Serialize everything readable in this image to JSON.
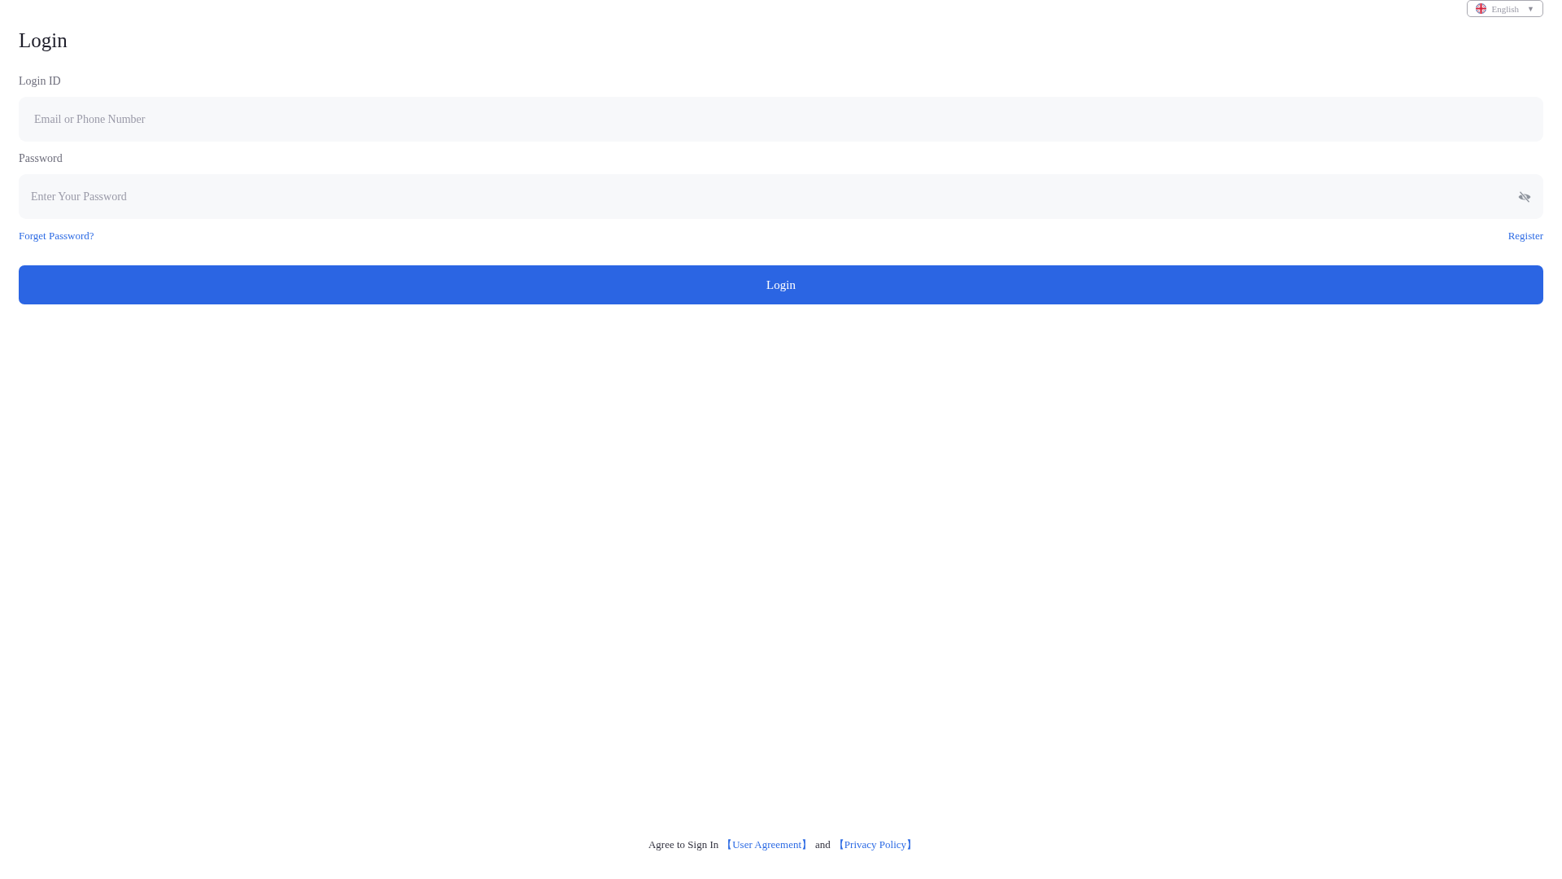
{
  "language_selector": {
    "label": "English",
    "caret": "▼"
  },
  "title": "Login",
  "form": {
    "fields": [
      {
        "kind": "text",
        "label": "Login ID",
        "placeholder": "Email or Phone Number"
      },
      {
        "kind": "password",
        "label": "Password",
        "placeholder": "Enter Your Password",
        "revealed": false
      }
    ],
    "links": [
      {
        "label": "Forget Password?"
      },
      {
        "label": "Register"
      }
    ],
    "submit": "Login"
  },
  "footer": [
    {
      "kind": "text",
      "text": "Agree to Sign In"
    },
    {
      "kind": "link",
      "text": "【User Agreement】"
    },
    {
      "kind": "text",
      "text": "and"
    },
    {
      "kind": "link",
      "text": "【Privacy Policy】"
    }
  ]
}
